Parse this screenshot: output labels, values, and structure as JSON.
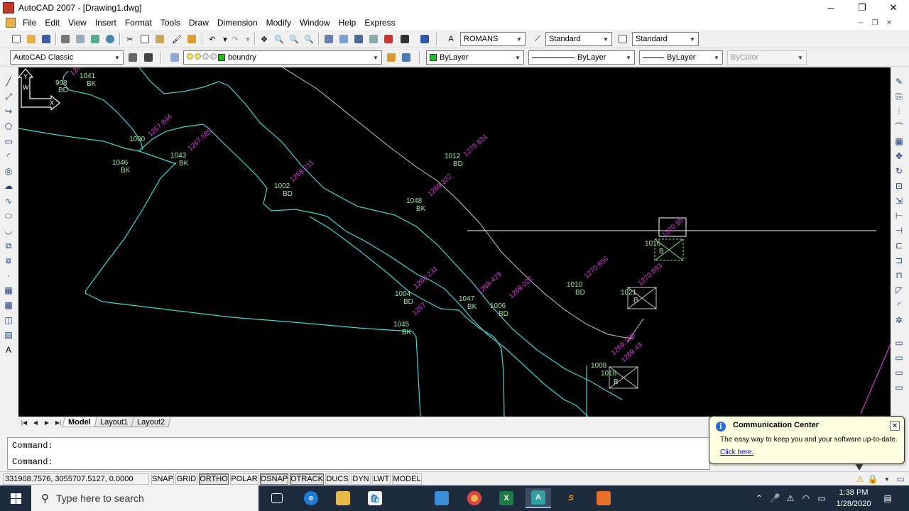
{
  "window": {
    "title": "AutoCAD 2007 - [Drawing1.dwg]",
    "controls": {
      "minimize": "─",
      "maximize": "❐",
      "close": "✕"
    }
  },
  "menu": [
    "File",
    "Edit",
    "View",
    "Insert",
    "Format",
    "Tools",
    "Draw",
    "Dimension",
    "Modify",
    "Window",
    "Help",
    "Express"
  ],
  "mdi_controls": {
    "minimize": "─",
    "restore": "❐",
    "close": "✕"
  },
  "toolbar": {
    "text_style": "ROMANS",
    "dim_style": "Standard",
    "table_style": "Standard",
    "workspace": "AutoCAD Classic",
    "layer": "boundry",
    "color": "ByLayer",
    "linetype": "ByLayer",
    "lineweight": "ByLayer",
    "plot_style": "ByColor"
  },
  "drawing": {
    "point_labels": [
      {
        "id": "908",
        "code": "BD"
      },
      {
        "id": "1041",
        "code": "BK"
      },
      {
        "id": "1000",
        "code": ""
      },
      {
        "id": "1043",
        "code": "BK"
      },
      {
        "id": "1046",
        "code": "BK"
      },
      {
        "id": "1002",
        "code": "BD"
      },
      {
        "id": "1012",
        "code": "BD"
      },
      {
        "id": "1048",
        "code": "BK"
      },
      {
        "id": "1004",
        "code": "BD"
      },
      {
        "id": "1047",
        "code": "BK"
      },
      {
        "id": "1006",
        "code": "BD"
      },
      {
        "id": "1045",
        "code": "BK"
      },
      {
        "id": "1010",
        "code": "BD"
      },
      {
        "id": "1021",
        "code": "B"
      },
      {
        "id": "1008",
        "code": ""
      },
      {
        "id": "1018",
        "code": "B"
      },
      {
        "id": "1016",
        "code": "B"
      }
    ],
    "elevations": [
      "1267.844",
      "1267.589",
      "1268.211",
      "1270.831",
      "1269.322",
      "1268.231",
      "1268.429",
      "1269.022",
      "1270.856",
      "1270.893",
      "1270.95",
      "1269.158",
      "1269.43",
      "1268",
      "1267"
    ],
    "ucs": {
      "y": "Y",
      "w": "W",
      "x": "X"
    }
  },
  "tabs": [
    "Model",
    "Layout1",
    "Layout2"
  ],
  "command": {
    "line1": "Command:",
    "line2": "Command:"
  },
  "status": {
    "coords": "331908.7576, 3055707.5127, 0.0000",
    "buttons": [
      "SNAP",
      "GRID",
      "ORTHO",
      "POLAR",
      "OSNAP",
      "OTRACK",
      "DUCS",
      "DYN",
      "LWT",
      "MODEL"
    ]
  },
  "comm_center": {
    "title": "Communication Center",
    "text": "The easy way to keep you and your software up-to-date.",
    "link": "Click here."
  },
  "taskbar": {
    "search_placeholder": "Type here to search",
    "time": "1:38 PM",
    "date": "1/28/2020"
  },
  "colors": {
    "canvas_bg": "#000000",
    "cyan": "#3fd6d6",
    "green_text": "#7cf07c",
    "magenta": "#d83ad8",
    "taskbar": "#1e2b3c"
  }
}
